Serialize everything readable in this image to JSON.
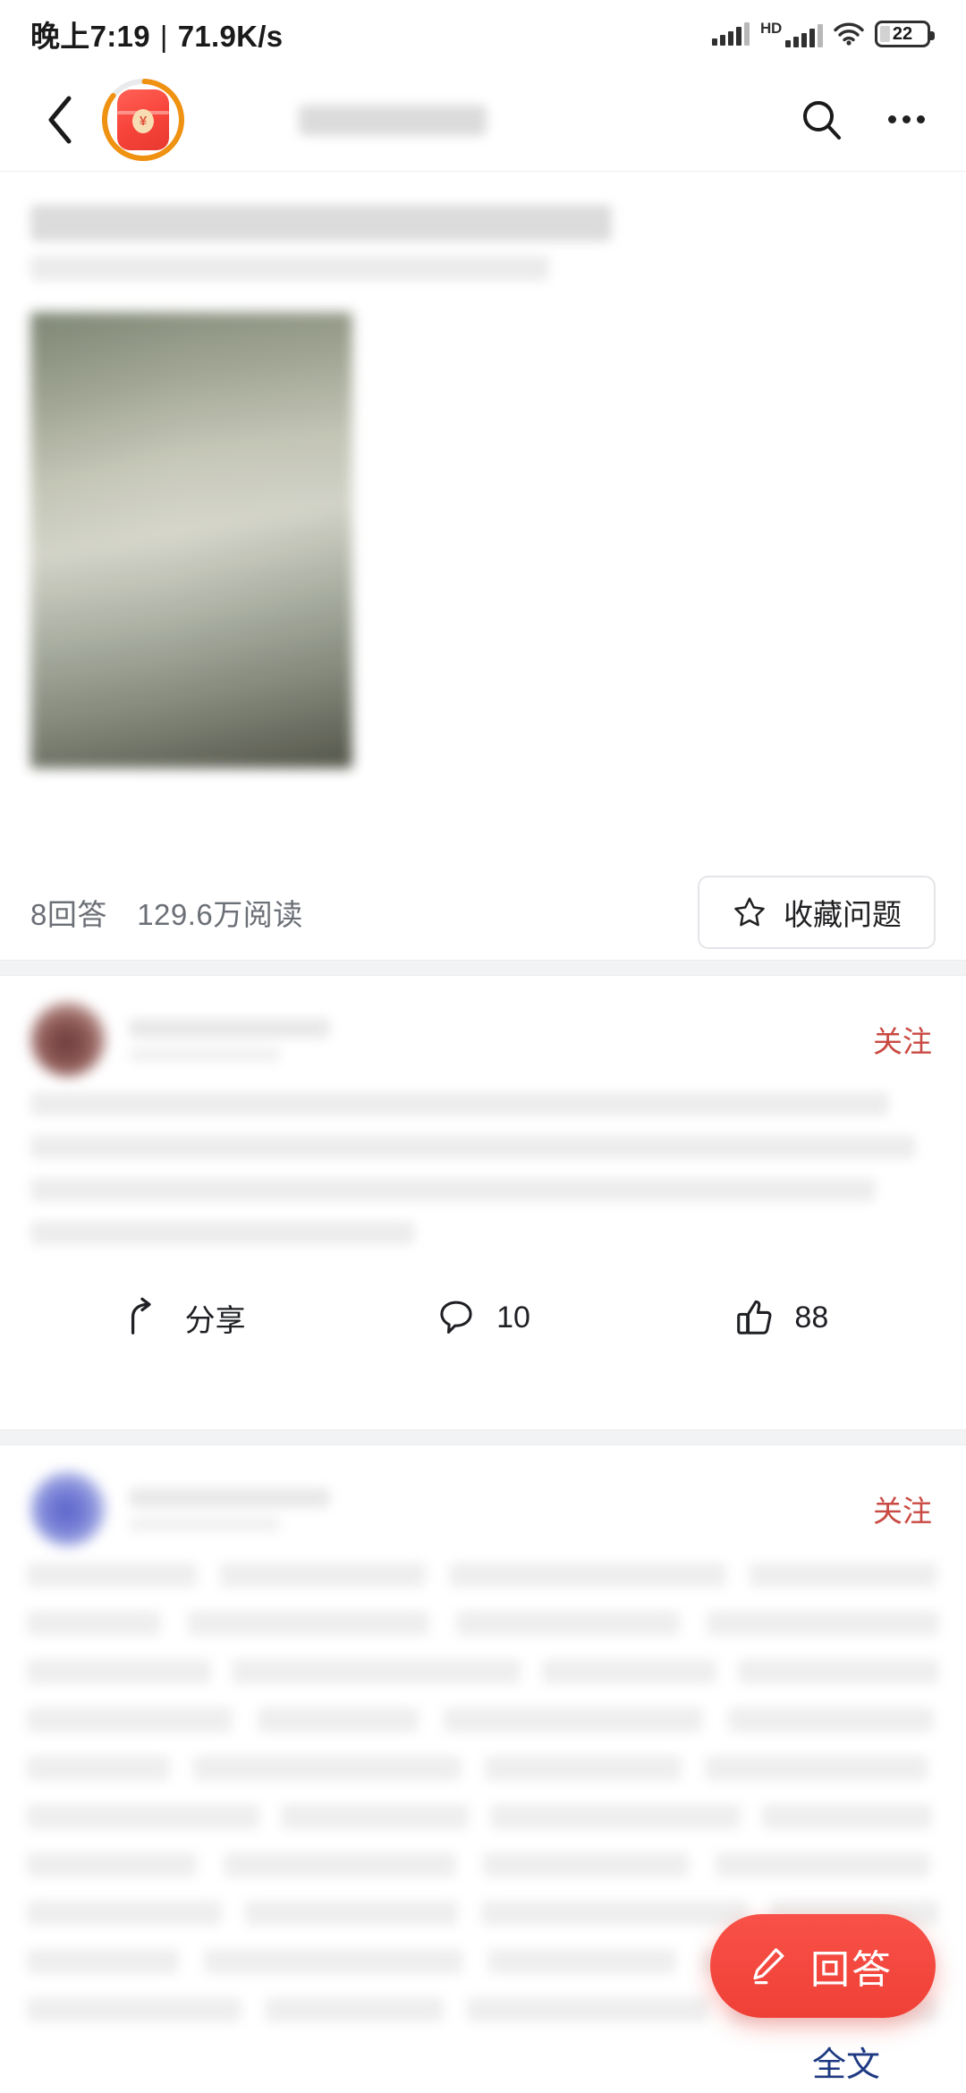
{
  "status_bar": {
    "time": "晚上7:19",
    "separator": "|",
    "network_speed": "71.9K/s",
    "hd_label": "HD",
    "battery_percent": "22",
    "icons": {
      "signal_1": "signal-bars-icon",
      "signal_2": "signal-bars-icon",
      "wifi": "wifi-icon",
      "battery": "battery-icon"
    }
  },
  "header": {
    "back_icon": "back-chevron-icon",
    "avatar": {
      "name": "red-envelope-avatar",
      "seal_symbol": "¥",
      "ring_color": "#ef9111"
    },
    "title": "",
    "search_icon": "search-icon",
    "more_icon": "more-options-icon"
  },
  "question": {
    "title_line_1": "",
    "title_line_2": "",
    "thumbnail": "question-image-thumbnail",
    "answer_count": "8回答",
    "read_count": "129.6万阅读",
    "collect_button": {
      "label": "收藏问题",
      "icon": "star-icon"
    }
  },
  "answers": [
    {
      "author_avatar": "author-avatar",
      "author_name": "",
      "author_bio": "",
      "follow_label": "关注",
      "body": "",
      "actions": {
        "share_label": "分享",
        "share_icon": "share-arrow-icon",
        "comment_count": "10",
        "comment_icon": "comment-bubble-icon",
        "like_count": "88",
        "like_icon": "thumbs-up-icon"
      }
    },
    {
      "author_avatar": "author-avatar",
      "author_name": "",
      "author_bio": "",
      "follow_label": "关注",
      "body": "",
      "expand_label": "全文"
    }
  ],
  "fab": {
    "label": "回答",
    "icon": "pencil-icon",
    "color": "#ef4036"
  },
  "colors": {
    "accent_red": "#ef4036",
    "follow_red": "#c94a43",
    "link_blue": "#1e3a82",
    "divider_gray": "#f2f3f5",
    "text_primary": "#1f2024",
    "text_secondary": "#6b6f76"
  }
}
